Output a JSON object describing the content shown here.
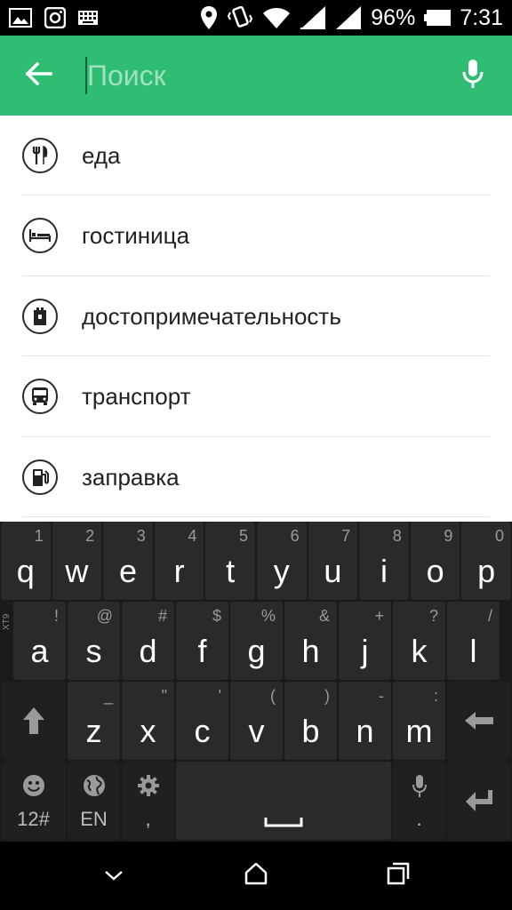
{
  "status_bar": {
    "battery_percent": "96%",
    "time": "7:31",
    "icons": [
      "image-icon",
      "instagram-icon",
      "keyboard-icon",
      "location-icon",
      "vibrate-icon",
      "wifi-icon",
      "signal-icon",
      "signal-icon",
      "battery-icon"
    ]
  },
  "search": {
    "placeholder": "Поиск",
    "value": ""
  },
  "suggestions": [
    {
      "label": "еда",
      "icon": "restaurant-icon"
    },
    {
      "label": "гостиница",
      "icon": "hotel-icon"
    },
    {
      "label": "достопримечательность",
      "icon": "landmark-icon"
    },
    {
      "label": "транспорт",
      "icon": "bus-icon"
    },
    {
      "label": "заправка",
      "icon": "gas-station-icon"
    }
  ],
  "keyboard": {
    "row1": [
      {
        "key": "q",
        "hint": "1"
      },
      {
        "key": "w",
        "hint": "2"
      },
      {
        "key": "e",
        "hint": "3"
      },
      {
        "key": "r",
        "hint": "4"
      },
      {
        "key": "t",
        "hint": "5"
      },
      {
        "key": "y",
        "hint": "6"
      },
      {
        "key": "u",
        "hint": "7"
      },
      {
        "key": "i",
        "hint": "8"
      },
      {
        "key": "o",
        "hint": "9"
      },
      {
        "key": "p",
        "hint": "0"
      }
    ],
    "row2": [
      {
        "key": "a",
        "hint": "!"
      },
      {
        "key": "s",
        "hint": "@"
      },
      {
        "key": "d",
        "hint": "#"
      },
      {
        "key": "f",
        "hint": "$"
      },
      {
        "key": "g",
        "hint": "%"
      },
      {
        "key": "h",
        "hint": "&"
      },
      {
        "key": "j",
        "hint": "+"
      },
      {
        "key": "k",
        "hint": "?"
      },
      {
        "key": "l",
        "hint": "/"
      }
    ],
    "xt9_label": "XT9",
    "row3": [
      {
        "key": "z",
        "hint": "_"
      },
      {
        "key": "x",
        "hint": "\""
      },
      {
        "key": "c",
        "hint": "'"
      },
      {
        "key": "v",
        "hint": "("
      },
      {
        "key": "b",
        "hint": ")"
      },
      {
        "key": "n",
        "hint": "-"
      },
      {
        "key": "m",
        "hint": ":"
      }
    ],
    "symbols_label": "12#",
    "language_label": "EN",
    "comma_label": ",",
    "period_label": "."
  },
  "colors": {
    "accent": "#2ebd73",
    "keyboard_bg": "#1a1a1a",
    "key_bg": "#2a2a2a"
  }
}
